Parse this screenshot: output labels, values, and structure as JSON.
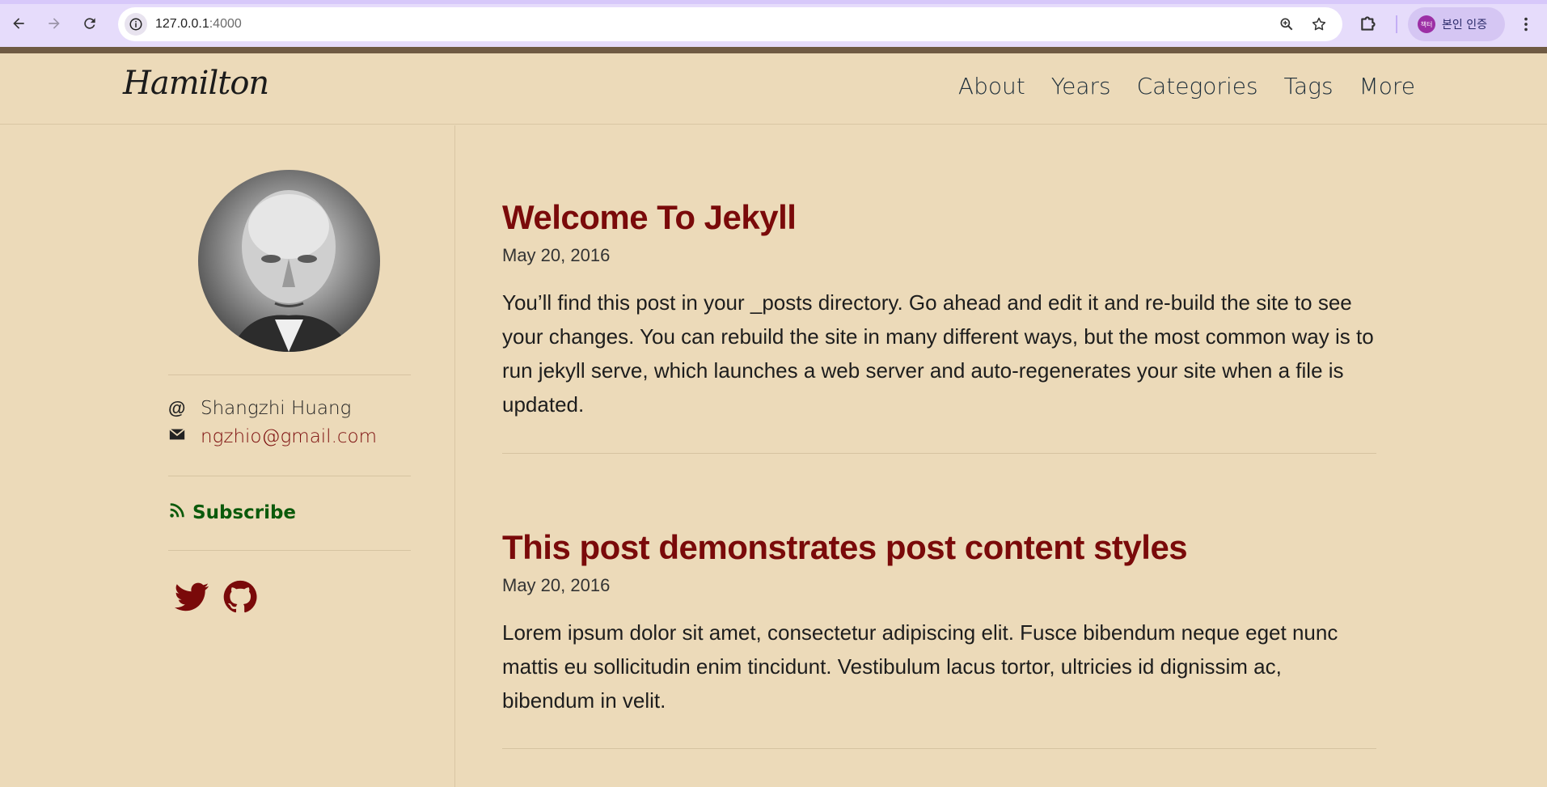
{
  "browser": {
    "url_host": "127.0.0.1",
    "url_port": ":4000",
    "profile_label": "본인 인증",
    "profile_badge": "책터"
  },
  "site": {
    "logo": "Hamilton",
    "nav": [
      "About",
      "Years",
      "Categories",
      "Tags",
      "More"
    ]
  },
  "sidebar": {
    "name_icon": "@",
    "name": "Shangzhi Huang",
    "email": "ngzhio@gmail.com",
    "subscribe": "Subscribe",
    "social": [
      "twitter-icon",
      "github-icon"
    ],
    "accent_color": "#7a0a0a",
    "subscribe_color": "#0b5a0b"
  },
  "posts": [
    {
      "title": "Welcome To Jekyll",
      "date": "May 20, 2016",
      "excerpt": "You’ll find this post in your _posts directory. Go ahead and edit it and re-build the site to see your changes. You can rebuild the site in many different ways, but the most common way is to run jekyll serve, which launches a web server and auto-regenerates your site when a file is updated."
    },
    {
      "title": "This post demonstrates post content styles",
      "date": "May 20, 2016",
      "excerpt": "Lorem ipsum dolor sit amet, consectetur adipiscing elit. Fusce bibendum neque eget nunc mattis eu sollicitudin enim tincidunt. Vestibulum lacus tortor, ultricies id dignissim ac, bibendum in velit."
    }
  ]
}
